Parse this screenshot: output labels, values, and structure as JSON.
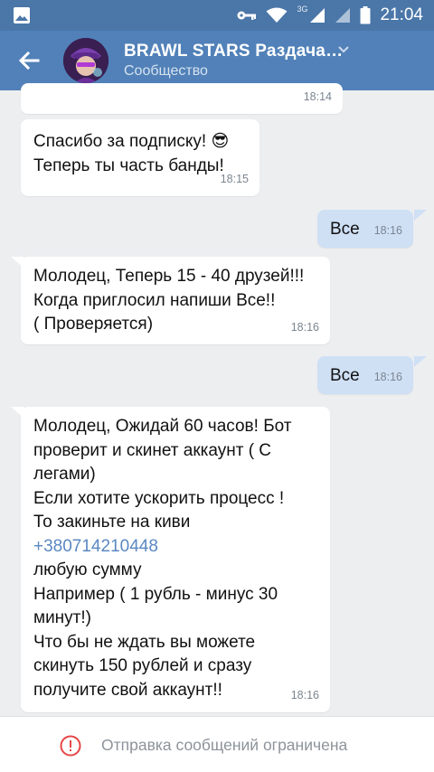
{
  "status_bar": {
    "time": "21:04",
    "network": "3G",
    "icons": [
      "image-icon",
      "key-icon",
      "wifi-icon",
      "signal-icon",
      "battery-icon"
    ]
  },
  "header": {
    "title": "BRAWL STARS Раздача…",
    "subtitle": "Сообщество",
    "icons": [
      "back-arrow-icon",
      "chevron-down-icon"
    ]
  },
  "colors": {
    "status_bar": "#4a76a8",
    "header": "#5181b8",
    "background": "#edeef0",
    "incoming_bubble": "#ffffff",
    "outgoing_bubble": "#cfe0f5",
    "link": "#5a88c2"
  },
  "messages": [
    {
      "direction": "in",
      "lines": [],
      "time": "18:14"
    },
    {
      "direction": "in",
      "lines": [
        "Спасибо за подписку! 😎",
        "Теперь ты часть банды!"
      ],
      "time": "18:15"
    },
    {
      "direction": "out",
      "lines": [
        "Все"
      ],
      "time": "18:16"
    },
    {
      "direction": "in",
      "lines": [
        "Молодец, Теперь 15 - 40 друзей!!!",
        "Когда приглосил напиши Все!!",
        "( Проверяется)"
      ],
      "time": "18:16"
    },
    {
      "direction": "out",
      "lines": [
        "Все"
      ],
      "time": "18:16"
    },
    {
      "direction": "in",
      "lines": [
        "Молодец, Ожидай 60 часов! Бот",
        "проверит и скинет аккаунт ( С",
        "легами)",
        "Если хотите ускорить процесс !",
        "То закиньте на киви",
        "+380714210448",
        "любую сумму",
        "Например ( 1 рубль - минус 30",
        "минут!)",
        "Что бы не ждать вы можете",
        "скинуть 150 рублей и сразу",
        "получите свой аккаунт!!"
      ],
      "time": "18:16",
      "link_line_index": 5
    }
  ],
  "bottom_bar": {
    "text": "Отправка сообщений ограничена",
    "icon": "warning-icon"
  }
}
